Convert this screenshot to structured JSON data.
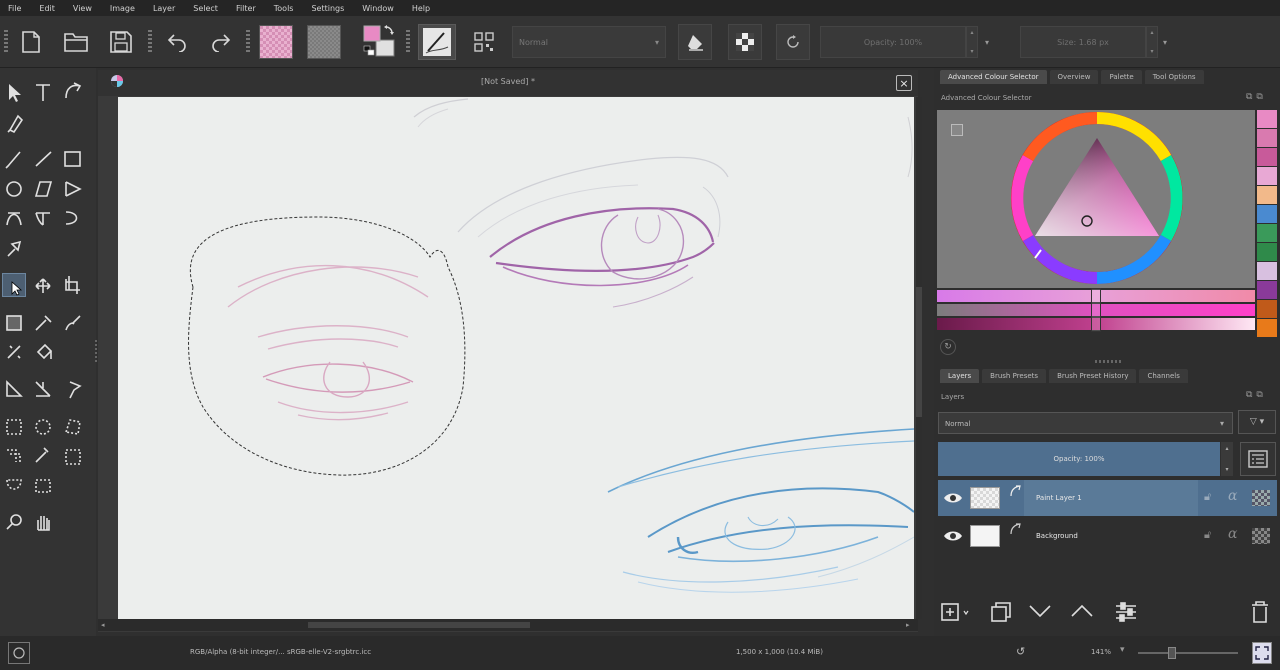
{
  "menu": [
    "File",
    "Edit",
    "View",
    "Image",
    "Layer",
    "Select",
    "Filter",
    "Tools",
    "Settings",
    "Window",
    "Help"
  ],
  "toolbar": {
    "blend_mode": "Normal",
    "opacity_label": "Opacity: 100%",
    "size_label": "Size: 1.68 px"
  },
  "document": {
    "title": "[Not Saved]",
    "modified_marker": "*"
  },
  "docker_top_tabs": [
    "Advanced Colour Selector",
    "Overview",
    "Palette",
    "Tool Options"
  ],
  "colour_selector": {
    "title": "Advanced Colour Selector",
    "swatches": [
      "#e88ac4",
      "#d97aaf",
      "#c85a9a",
      "#e8a8d4",
      "#f2b98a",
      "#4a8ad0",
      "#3a9a5a",
      "#2f8a4a",
      "#d8c0e0",
      "#8a3a9a",
      "#c05a1a",
      "#e87a1a"
    ]
  },
  "docker_bottom_tabs": [
    "Layers",
    "Brush Presets",
    "Brush Preset History",
    "Channels"
  ],
  "layers": {
    "title": "Layers",
    "blend_mode": "Normal",
    "opacity_label": "Opacity: 100%",
    "items": [
      {
        "name": "Paint Layer 1"
      },
      {
        "name": "Background"
      }
    ]
  },
  "status": {
    "color_space": "RGB/Alpha (8-bit integer/... sRGB-elle-V2-srgbtrc.icc",
    "dimensions": "1,500 x 1,000 (10.4 MiB)",
    "zoom": "141%"
  },
  "colors": {
    "accent": "#4f6f8f",
    "canvas": "#eceeed",
    "pink_sketch": "#d8a8c0",
    "purple_sketch": "#9a4a9a",
    "blue_sketch": "#5a9ac8"
  }
}
